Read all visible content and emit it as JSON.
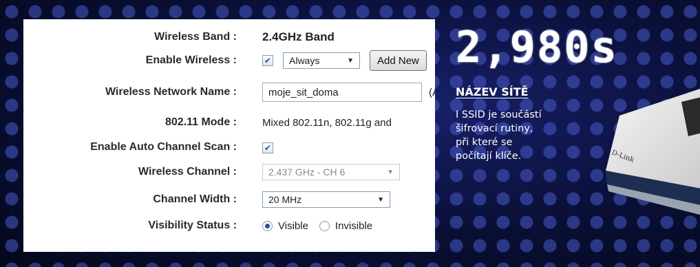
{
  "settings": {
    "wireless_band": {
      "label": "Wireless Band :",
      "value": "2.4GHz Band"
    },
    "enable_wireless": {
      "label": "Enable Wireless :",
      "checked": true,
      "schedule": "Always",
      "add_new": "Add New"
    },
    "network_name": {
      "label": "Wireless Network Name :",
      "value": "moje_sit_doma",
      "trailing": "(A"
    },
    "mode": {
      "label": "802.11 Mode :",
      "value": "Mixed 802.11n, 802.11g and"
    },
    "auto_channel": {
      "label": "Enable Auto Channel Scan :",
      "checked": true
    },
    "channel": {
      "label": "Wireless Channel :",
      "value": "2.437 GHz - CH 6"
    },
    "channel_width": {
      "label": "Channel Width :",
      "value": "20 MHz"
    },
    "visibility": {
      "label": "Visibility Status :",
      "options": [
        "Visible",
        "Invisible"
      ],
      "selected": "Visible"
    }
  },
  "article": {
    "headline": "2,980s",
    "section_title": "NÁZEV SÍTĚ",
    "section_body": "I SSID je součástí\nšifrovací rutiny,\npři které se\npočítají klíče."
  },
  "router": {
    "brand": "D-Link"
  },
  "colors": {
    "background": "#0b1230",
    "panel": "#ffffff",
    "accent": "#2c4f9e"
  }
}
